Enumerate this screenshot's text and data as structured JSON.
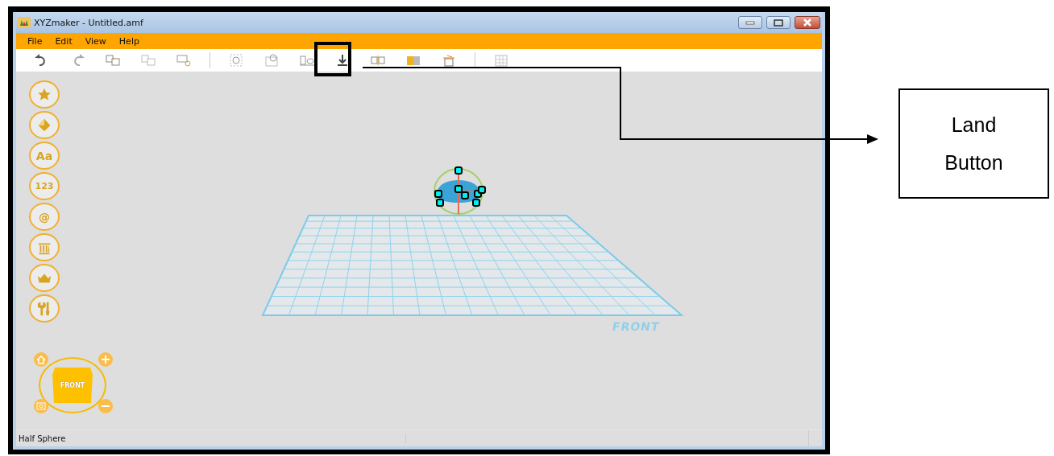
{
  "window": {
    "title": "XYZmaker - Untitled.amf"
  },
  "menu": [
    "File",
    "Edit",
    "View",
    "Help"
  ],
  "toolbar": [
    {
      "kind": "undo"
    },
    {
      "kind": "redo"
    },
    {
      "kind": "copy"
    },
    {
      "kind": "paste"
    },
    {
      "kind": "duplicate"
    },
    {
      "kind": "separator"
    },
    {
      "kind": "group"
    },
    {
      "kind": "ungroup"
    },
    {
      "kind": "align"
    },
    {
      "kind": "land"
    },
    {
      "kind": "split"
    },
    {
      "kind": "box"
    },
    {
      "kind": "delete"
    },
    {
      "kind": "separator"
    },
    {
      "kind": "grid"
    }
  ],
  "shape_tools": [
    {
      "kind": "star"
    },
    {
      "kind": "pyramid"
    },
    {
      "kind": "glyph",
      "glyph": "Aa"
    },
    {
      "kind": "glyph",
      "glyph": "123"
    },
    {
      "kind": "glyph",
      "glyph": "@"
    },
    {
      "kind": "column"
    },
    {
      "kind": "crown"
    },
    {
      "kind": "tools"
    }
  ],
  "viewport": {
    "plate_label": "FRONT",
    "view_cube_label": "FRONT"
  },
  "status_bar": {
    "text": "Half Sphere"
  },
  "callout": {
    "text": "Land Button"
  }
}
